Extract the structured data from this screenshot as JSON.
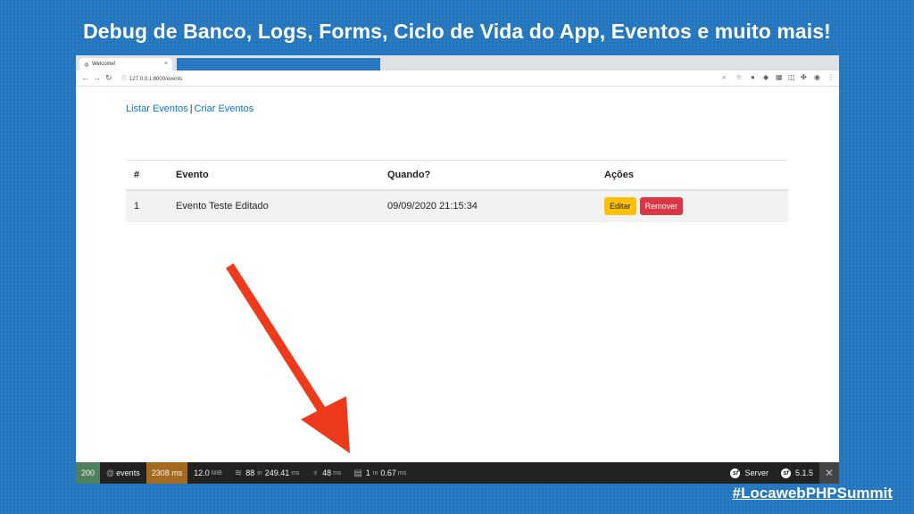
{
  "slide": {
    "title": "Debug de Banco, Logs, Forms, Ciclo de Vida do App, Eventos e muito mais!",
    "hashtag": "#LocawebPHPSummit"
  },
  "browser": {
    "tab_title": "Welcome!",
    "url": "127.0.0.1:8000/events"
  },
  "page": {
    "links": [
      "Listar Eventos",
      "Criar Eventos"
    ],
    "table": {
      "headers": [
        "#",
        "Evento",
        "Quando?",
        "Ações"
      ],
      "rows": [
        {
          "id": "1",
          "evento": "Evento Teste Editado",
          "quando": "09/09/2020 21:15:34",
          "edit_label": "Editar",
          "remove_label": "Remover"
        }
      ]
    }
  },
  "debugbar": {
    "status": "200",
    "route_prefix": "@",
    "route": "events",
    "time": "2308 ms",
    "memory": "12.0",
    "memory_unit": "MiB",
    "db_count": "88",
    "db_in": "in",
    "db_time": "249.41",
    "db_time_unit": "ms",
    "twig_time": "48",
    "twig_unit": "ms",
    "cache_count": "1",
    "cache_in": "in",
    "cache_time": "0.67",
    "cache_unit": "ms",
    "server_label": "Server",
    "version": "5.1.5"
  },
  "colors": {
    "background": "#2476bf",
    "arrow": "#ee3a1c",
    "link": "#0b74d1",
    "edit": "#ffc107",
    "remove": "#dc3545"
  }
}
